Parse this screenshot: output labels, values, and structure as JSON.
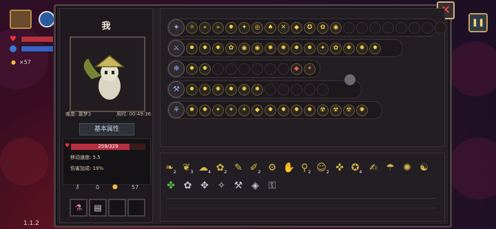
{
  "character": {
    "name": "我",
    "difficulty": "难度: 噩梦3",
    "time_used": "用时: 00:49:36",
    "attr_button": "基本属性",
    "hp_text": "259/329",
    "hp_fraction": 0.787,
    "move_speed": "移动速度: 5.5",
    "damage_bonus": "伤害加成: 19%",
    "keys": "0",
    "coins": "57"
  },
  "hud": {
    "coins": "×57",
    "version": "1.1.2"
  },
  "buttons": {
    "close": "✕",
    "pause": "❚❚"
  },
  "rows": [
    {
      "lead": "✦",
      "icons": [
        "☼",
        "»",
        "»",
        "✹",
        "✦",
        "◎",
        "♠",
        "✕",
        "◆",
        "✪",
        "✿",
        "◉"
      ],
      "empty": 8
    },
    {
      "lead": "⚔",
      "icons": [
        "✹",
        "✹",
        "✹",
        "✿",
        "◉",
        "◉",
        "✺",
        "✺",
        "✸",
        "✸",
        "✦",
        "✿",
        "✹",
        "✺",
        "✹"
      ],
      "empty": 0
    },
    {
      "lead": "❄",
      "icons": [
        "✹",
        "✹"
      ],
      "empty": 6,
      "extra": [
        "◆",
        "✦"
      ]
    },
    {
      "lead": "⚒",
      "icons": [
        "✹",
        "✹",
        "✺",
        "✸",
        "✺",
        "✸"
      ],
      "empty": 5
    },
    {
      "lead": "⚘",
      "icons": [
        "✹",
        "✹",
        "✦",
        "✶",
        "✶",
        "◆",
        "✹",
        "✹",
        "✹",
        "✹",
        "☢",
        "☢",
        "☢",
        "✺"
      ],
      "empty": 0
    }
  ],
  "items_row1": [
    "❧",
    "❦",
    "☁",
    "✿",
    "✎",
    "✐",
    "⚙",
    "✋",
    "⚲",
    "☺",
    "✜",
    "✪",
    "✍",
    "☂",
    "✺",
    "☯"
  ],
  "items_row1_counts": [
    "2",
    "3",
    "4",
    "2",
    "",
    "2",
    "",
    "",
    "2",
    "2",
    "",
    "4",
    "",
    "",
    "",
    ""
  ],
  "items_row2": [
    "✤",
    "✿",
    "✥",
    "✧",
    "⚒",
    "◈",
    "⚿"
  ]
}
